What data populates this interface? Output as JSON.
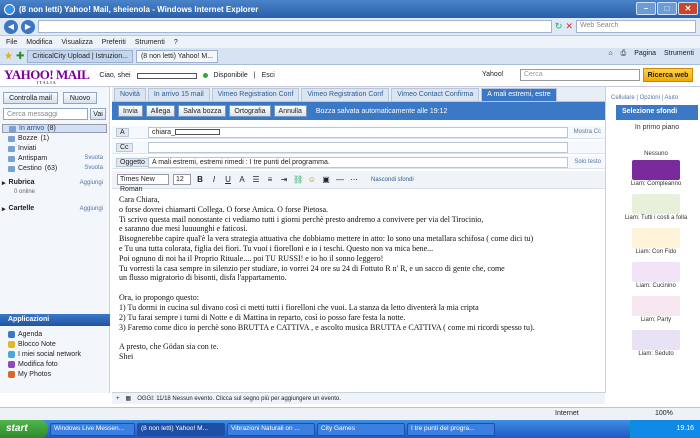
{
  "window": {
    "title": "(8 non letti) Yahoo! Mail, sheienola - Windows Internet Explorer"
  },
  "address": {
    "url": "",
    "search_placeholder": "Web Search"
  },
  "menu": [
    "File",
    "Modifica",
    "Visualizza",
    "Preferiti",
    "Strumenti",
    "?"
  ],
  "browser_tabs": [
    "CriticalCity Upload | Istruzion...",
    "(8 non letti) Yahoo! M..."
  ],
  "commands": [
    "Pagina",
    "Strumenti"
  ],
  "yahoo": {
    "logo": "YAHOO! MAIL",
    "logo_sub": "ITALIA",
    "greeting": "Ciao, shei",
    "status": "Disponibile",
    "logout": "Esci",
    "search_label": "Yahoo!",
    "search_placeholder": "Cerca",
    "web_button": "Ricerca web"
  },
  "sidebar": {
    "check_button": "Controlla mail",
    "new_button": "Nuovo",
    "search_placeholder": "Cerca messaggi",
    "go": "Vai",
    "folders": [
      {
        "label": "In arrivo",
        "count": "(8)"
      },
      {
        "label": "Bozze",
        "count": "(1)"
      },
      {
        "label": "Inviati",
        "count": ""
      },
      {
        "label": "Antispam",
        "count": "",
        "action": "Svuota"
      },
      {
        "label": "Cestino",
        "count": "(63)",
        "action": "Svuota"
      }
    ],
    "contacts": {
      "label": "Rubrica",
      "status": "0 online",
      "action": "Aggiungi"
    },
    "folders_section": {
      "label": "Cartelle",
      "action": "Aggiungi"
    },
    "apps_header": "Applicazioni",
    "apps": [
      "Agenda",
      "Blocco Note",
      "I miei social network",
      "Modifica foto",
      "My Photos"
    ]
  },
  "mail_tabs": [
    "Novità",
    "In arrivo  15 mail",
    "Vimeo Registration Conf",
    "Vimeo Registration Conf",
    "Vimeo Contact Confirma",
    "A mali estremi, estre"
  ],
  "compose": {
    "send": "Invia",
    "attach": "Allega",
    "save": "Salva bozza",
    "spelling": "Ortografia",
    "cancel": "Annulla",
    "saved_msg": "Bozza salvata automaticamente alle 19:12",
    "to_label": "A",
    "to_value": "chiara_",
    "show_cc": "Mostra Cc",
    "cc_label": "Cc",
    "subject_label": "Oggetto",
    "subject_value": "A mali estremi, estremi rimedi : I tre punti del programma.",
    "plain": "Solo testo",
    "font": "Times New Roman",
    "size": "12",
    "hide_bg": "Nascondi sfondi"
  },
  "body_lines": [
    "Cara Chiara,",
    "o forse dovrei chiamarti Collega. O forse Amica. O forse Pietosa.",
    "Ti scrivo questa mail nonostante ci vediamo tutti i giorni perchè presto andremo a convivere per via del Tirocinio,",
    "e saranno due mesi luuuunghi e faticosi.",
    "Bisognerebbe capire qual'è la vera strategia attuativa che dobbiamo mettere in atto: Io sono una metallara schifosa ( come dici tu)",
    "e Tu una tutta colorata, figlia dei fiori. Tu vuoi i fiorelloni e io i teschi. Questo non va mica bene...",
    "Poi ognuno di noi ha il Proprio Rituale.... poi TU RUSSI! e io ho il sonno leggero!",
    "Tu vorresti la casa sempre in silenzio per studiare, io vorrei 24 ore su 24 di Fottuto R n' R, e un sacco di gente che, come",
    "un flusso migratorio di bisonti, disfa l'appartamento.",
    "",
    "Ora, io propongo questo:",
    "1) Tu dormi in cucina sul divano così ci metti tutti i fiorelloni che vuoi. La stanza da letto diventerà la mia cripta",
    "2) Tu farai sempre i turni di Notte e di Mattina in reparto, così io posso fare festa la notte.",
    "3) Faremo come dico io perchè sono BRUTTA e CATTIVA , e ascolto musica BRUTTA e CATTIVA ( come mi ricordi spesso tu).",
    "",
    "A presto, che Gödan sia con te.",
    " Shei"
  ],
  "right_panel": {
    "links": "Cellulare | Opzioni | Aiuto",
    "header": "Selezione sfondi",
    "subheader": "In primo piano",
    "cards": [
      {
        "label": "Nessuno",
        "color": "#ffffff"
      },
      {
        "label": "Liam: Compleanno",
        "color": "#7a2a9a"
      },
      {
        "label": "Liam: Tutti i costi a folla",
        "color": "#e7f0d8"
      },
      {
        "label": "Liam: Con Fido",
        "color": "#fff3d9"
      },
      {
        "label": "Liam: Cucinino",
        "color": "#f1e4f7"
      },
      {
        "label": "Liam: Party",
        "color": "#f7e7f0"
      },
      {
        "label": "Liam: Seduto",
        "color": "#e9e2f5"
      }
    ]
  },
  "compose_status": "OGGI: 11/18  Nessun evento. Clicca sul segno più per aggiungere un evento.",
  "ie_status": {
    "zone": "Internet",
    "zoom": "100%"
  },
  "taskbar": {
    "start": "start",
    "items": [
      "Windows Live Messen...",
      "(8 non letti) Yahoo! M...",
      "Vibrazioni Naturali on ...",
      "City Games",
      "I tre punti del progra..."
    ],
    "time": "19.16"
  }
}
